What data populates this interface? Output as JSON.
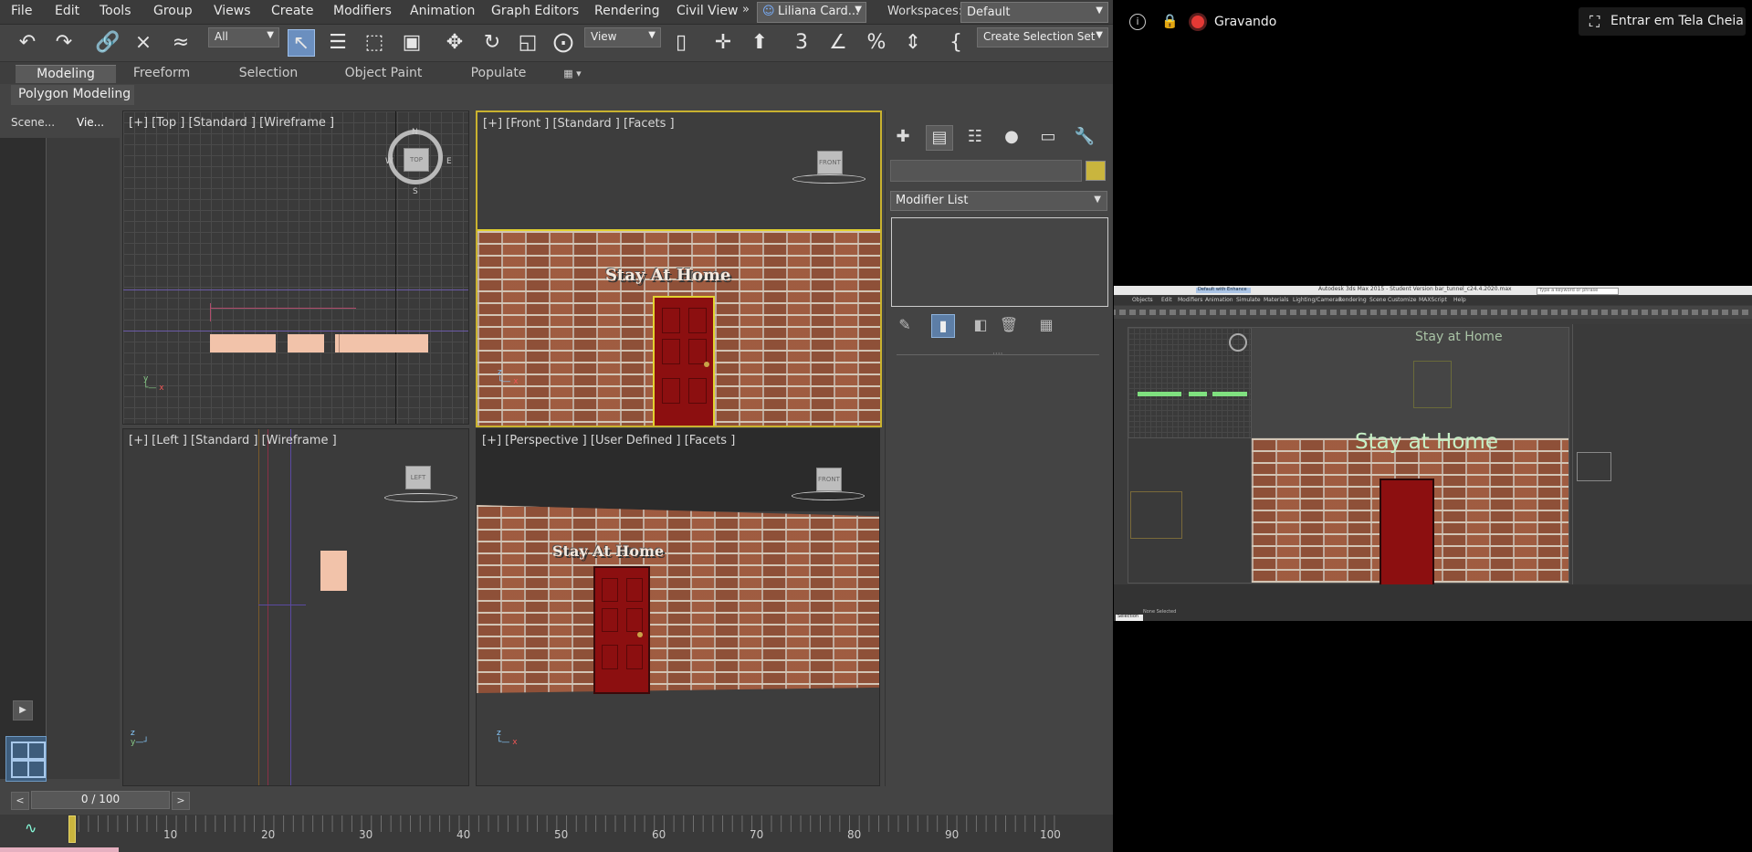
{
  "menubar": {
    "items": [
      "File",
      "Edit",
      "Tools",
      "Group",
      "Views",
      "Create",
      "Modifiers",
      "Animation",
      "Graph Editors",
      "Rendering",
      "Civil View"
    ],
    "more": "»",
    "user": "Liliana Card...",
    "workspaces_label": "Workspaces:",
    "workspace": "Default"
  },
  "toolbar": {
    "filter": "All",
    "view": "View",
    "selection_set": "Create Selection Set"
  },
  "ribbon": {
    "tabs": [
      "Modeling",
      "Freeform",
      "Selection",
      "Object Paint",
      "Populate"
    ],
    "sub": "Polygon Modeling"
  },
  "left_panel": {
    "tabs": [
      "Scene...",
      "Vie..."
    ]
  },
  "viewports": {
    "top": "[+] [Top ] [Standard ] [Wireframe ]",
    "front": "[+] [Front ] [Standard ] [Facets ]",
    "left": "[+] [Left ] [Standard ] [Wireframe ]",
    "perspective": "[+] [Perspective ] [User Defined ] [Facets ]",
    "sign_text": "Stay At Home",
    "cube_top": "TOP",
    "cube_front": "FRONT",
    "cube_left": "LEFT",
    "compass": {
      "n": "N",
      "s": "S",
      "e": "E",
      "w": "W"
    }
  },
  "command_panel": {
    "modifier_list": "Modifier List",
    "object_color": "#c9b53e"
  },
  "timeline": {
    "frame": "0 / 100",
    "ticks": [
      "10",
      "20",
      "30",
      "40",
      "50",
      "60",
      "70",
      "80",
      "90",
      "100"
    ],
    "current": 0,
    "total": 100
  },
  "meeting": {
    "recording_label": "Gravando",
    "fullscreen_label": "Entrar em Tela Cheia"
  },
  "shared_screen": {
    "title": "Autodesk 3ds Max 2015 - Student Version    bar_tunnel_c24.4.2020.max",
    "workspace": "Default with Enhance",
    "search_placeholder": "Type a keyword or phrase",
    "menu": [
      "Objects",
      "Edit",
      "Modifiers",
      "Animation",
      "Simulate",
      "Materials",
      "Lighting/Cameras",
      "Rendering",
      "Scene",
      "Customize",
      "MAXScript",
      "Help"
    ],
    "sign_front": "Stay at Home",
    "sign_persp": "Stay at Home",
    "status": "None Selected",
    "selection": "Selection"
  }
}
